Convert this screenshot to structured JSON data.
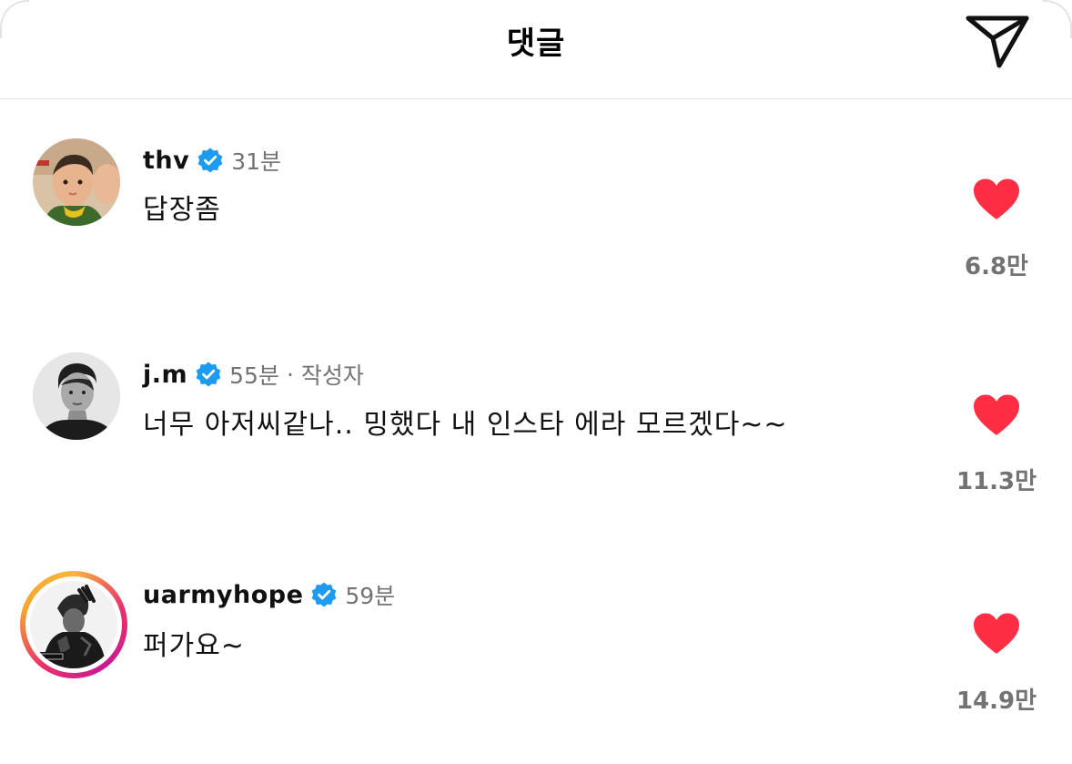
{
  "header": {
    "title": "댓글",
    "share_icon": "paper-plane-icon"
  },
  "colors": {
    "verified": "#1d9bf0",
    "like": "#ff2e44",
    "secondary_text": "#737373",
    "story_ring": [
      "#f9b43c",
      "#e8306c",
      "#c91a94"
    ]
  },
  "comments": [
    {
      "username": "thv",
      "verified": true,
      "time": "31분",
      "author_tag": "",
      "text": "답장좀",
      "liked": true,
      "like_count": "6.8만",
      "avatar_icon": "child-photo-avatar",
      "story_ring": false
    },
    {
      "username": "j.m",
      "verified": true,
      "time": "55분",
      "author_tag": "작성자",
      "text": "너무 아저씨같나.. 밍했다 내 인스타 에라 모르겠다~~",
      "liked": true,
      "like_count": "11.3만",
      "avatar_icon": "bw-portrait-avatar",
      "story_ring": false
    },
    {
      "username": "uarmyhope",
      "verified": true,
      "time": "59분",
      "author_tag": "",
      "text": "퍼가요~",
      "liked": true,
      "like_count": "14.9만",
      "avatar_icon": "bw-photo-avatar",
      "story_ring": true
    }
  ]
}
